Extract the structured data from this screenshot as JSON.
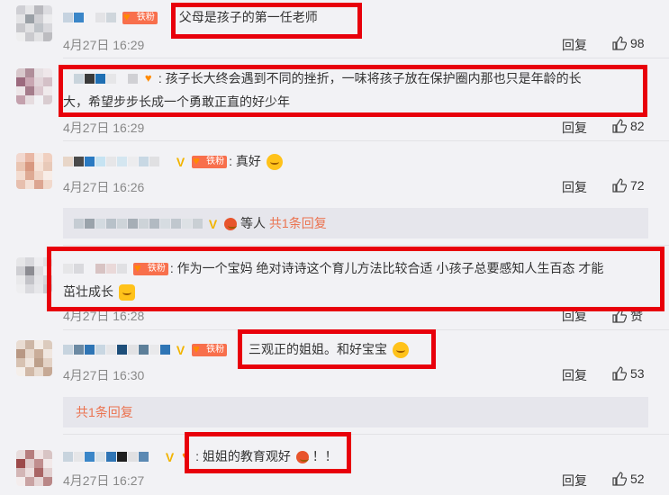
{
  "badge_label": "铁粉",
  "reply_label": "回复",
  "comments": [
    {
      "time": "4月27日 16:29",
      "text": "父母是孩子的第一任老师",
      "likes": "98"
    },
    {
      "time": "4月27日 16:29",
      "text_line1": "孩子长大终会遇到不同的挫折，一味将孩子放在保护圈内那也只是年龄的长",
      "text_line2": "大，希望步步长成一个勇敢正直的好少年",
      "likes": "82"
    },
    {
      "time": "4月27日 16:26",
      "text": "真好",
      "likes": "72"
    },
    {
      "time": "4月27日 16:28",
      "text_line1": "作为一个宝妈 绝对诗诗这个育儿方法比较合适 小孩子总要感知人生百态 才能",
      "text_line2": "茁壮成长",
      "likes": "赞"
    },
    {
      "time": "4月27日 16:30",
      "text": "三观正的姐姐。和好宝宝",
      "likes": "53"
    },
    {
      "time": "4月27日 16:27",
      "text": "姐姐的教育观好",
      "text_tail": "！！",
      "likes": "52"
    }
  ],
  "sub_reply_1": {
    "others": "等人",
    "link": "共1条回复"
  },
  "sub_reply_2": {
    "link": "共1条回复"
  },
  "colors": {
    "highlight": "#e8000b",
    "link": "#eb7350",
    "badge": "#f86f4c"
  },
  "icons": [
    "thumbs-up-icon",
    "fan-badge-icon",
    "verified-icon",
    "emoji-icon"
  ]
}
